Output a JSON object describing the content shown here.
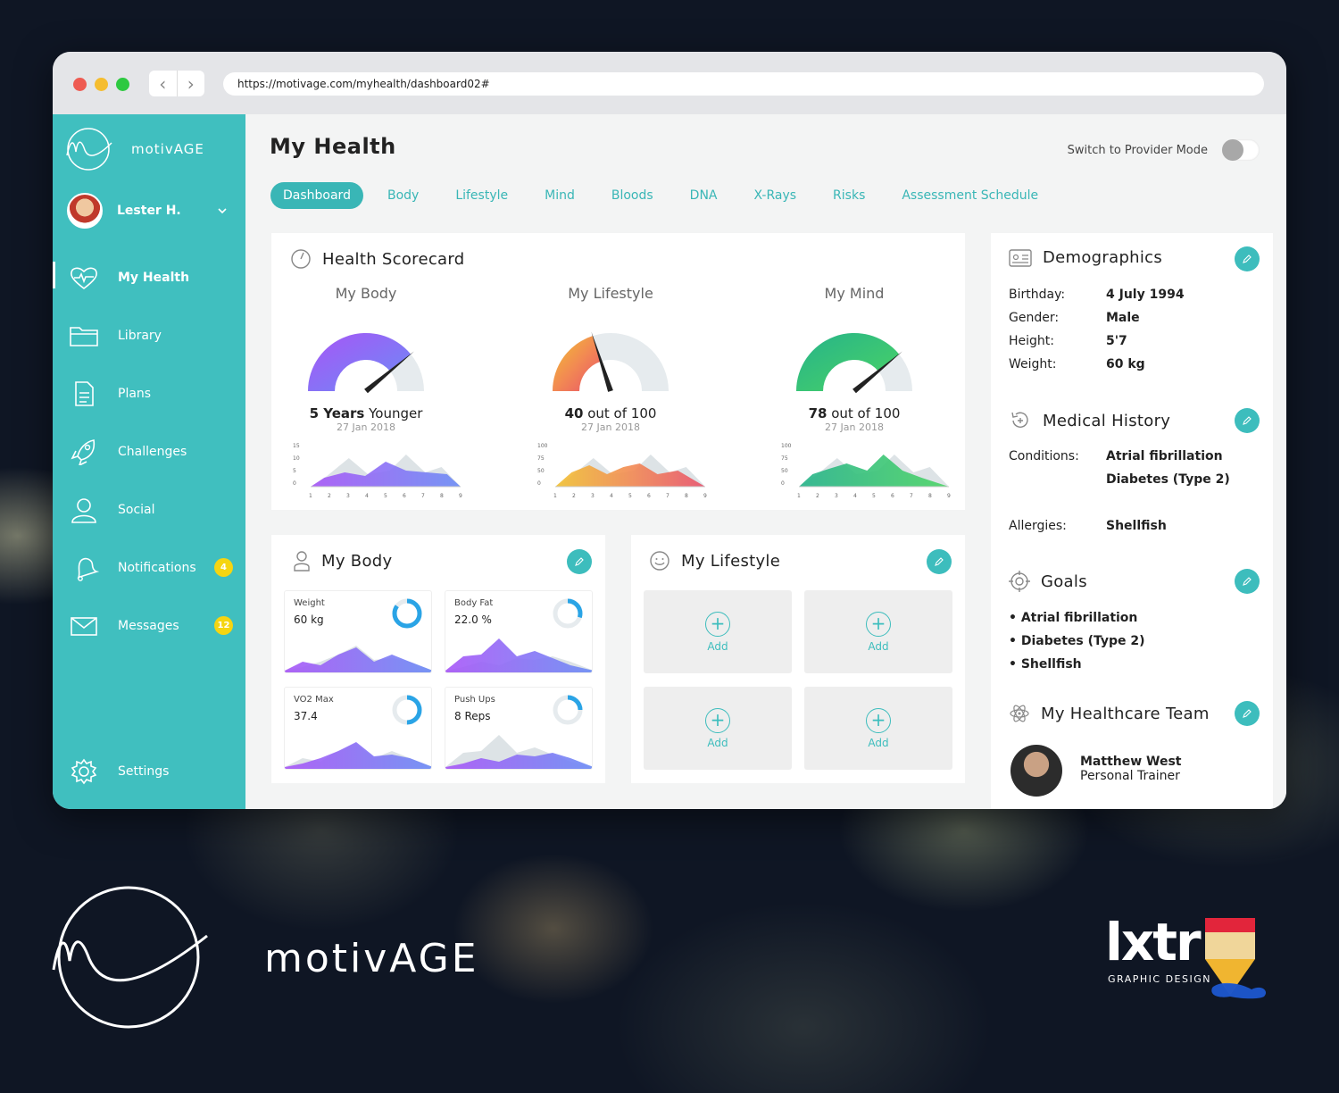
{
  "browser": {
    "url": "https://motivage.com/myhealth/dashboard02#"
  },
  "brand": {
    "name": "motivAGE"
  },
  "user": {
    "name": "Lester H."
  },
  "nav": [
    {
      "label": "My Health",
      "icon": "heart-pulse-icon",
      "badge": ""
    },
    {
      "label": "Library",
      "icon": "folder-icon",
      "badge": ""
    },
    {
      "label": "Plans",
      "icon": "document-icon",
      "badge": ""
    },
    {
      "label": "Challenges",
      "icon": "rocket-icon",
      "badge": ""
    },
    {
      "label": "Social",
      "icon": "user-icon",
      "badge": ""
    },
    {
      "label": "Notifications",
      "icon": "bell-icon",
      "badge": "4"
    },
    {
      "label": "Messages",
      "icon": "envelope-icon",
      "badge": "12"
    }
  ],
  "settings": {
    "label": "Settings"
  },
  "page": {
    "title": "My Health",
    "provider_label": "Switch to Provider Mode",
    "provider_on": false
  },
  "tabs": [
    "Dashboard",
    "Body",
    "Lifestyle",
    "Mind",
    "Bloods",
    "DNA",
    "X-Rays",
    "Risks",
    "Assessment Schedule"
  ],
  "scorecard": {
    "title": "Health Scorecard",
    "gauges": [
      {
        "name": "My Body",
        "value_bold": "5 Years",
        "value_rest": " Younger",
        "date": "27 Jan 2018",
        "level": 0.78,
        "yticks": [
          "15",
          "10",
          "5",
          "0"
        ],
        "xticks": [
          "1",
          "2",
          "3",
          "4",
          "5",
          "6",
          "7",
          "8",
          "9"
        ]
      },
      {
        "name": "My Lifestyle",
        "value_bold": "40",
        "value_rest": " out of 100",
        "date": "27 Jan 2018",
        "level": 0.4,
        "yticks": [
          "100",
          "75",
          "50",
          "0"
        ],
        "xticks": [
          "1",
          "2",
          "3",
          "4",
          "5",
          "6",
          "7",
          "8",
          "9"
        ]
      },
      {
        "name": "My Mind",
        "value_bold": "78",
        "value_rest": " out of 100",
        "date": "27 Jan 2018",
        "level": 0.78,
        "yticks": [
          "100",
          "75",
          "50",
          "0"
        ],
        "xticks": [
          "1",
          "2",
          "3",
          "4",
          "5",
          "6",
          "7",
          "8",
          "9"
        ]
      }
    ]
  },
  "my_body": {
    "title": "My Body",
    "metrics": [
      {
        "label": "Weight",
        "value": "60 kg",
        "ring": 0.85
      },
      {
        "label": "Body Fat",
        "value": "22.0 %",
        "ring": 0.3
      },
      {
        "label": "VO2 Max",
        "value": "37.4",
        "ring": 0.5
      },
      {
        "label": "Push Ups",
        "value": "8 Reps",
        "ring": 0.25
      }
    ]
  },
  "my_lifestyle": {
    "title": "My Lifestyle",
    "add_label": "Add"
  },
  "demographics": {
    "title": "Demographics",
    "rows": [
      {
        "k": "Birthday:",
        "v": "4 July 1994"
      },
      {
        "k": "Gender:",
        "v": "Male"
      },
      {
        "k": "Height:",
        "v": "5'7"
      },
      {
        "k": "Weight:",
        "v": "60 kg"
      }
    ]
  },
  "medical": {
    "title": "Medical History",
    "conditions_label": "Conditions:",
    "conditions": [
      "Atrial fibrillation",
      "Diabetes (Type 2)"
    ],
    "allergies_label": "Allergies:",
    "allergies": "Shellfish"
  },
  "goals": {
    "title": "Goals",
    "items": [
      "• Atrial fibrillation",
      "• Diabetes (Type 2)",
      "• Shellfish"
    ]
  },
  "team": {
    "title": "My Healthcare Team",
    "member_name": "Matthew West",
    "member_role": "Personal Trainer"
  },
  "footer": {
    "brand": "motivAGE",
    "studio_name": "lxtr",
    "studio_sub": "GRAPHIC DESIGN"
  },
  "colors": {
    "accent": "#40bfbf",
    "badge": "#f5d511"
  }
}
